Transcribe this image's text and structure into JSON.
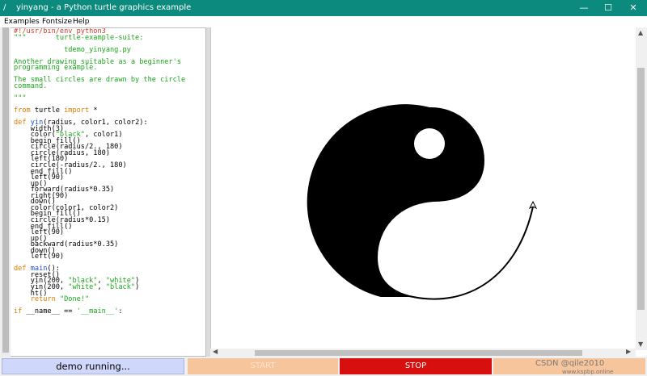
{
  "window": {
    "title": "yinyang - a Python turtle graphics example",
    "controls": {
      "minimize": "—",
      "maximize": "☐",
      "close": "✕"
    }
  },
  "menu": {
    "items": [
      "Examples",
      "Fontsize",
      "Help"
    ]
  },
  "code_lines": [
    [
      {
        "t": "#!/usr/bin/env python3",
        "c": "red"
      }
    ],
    [
      {
        "t": "\"\"\"       turtle-example-suite:",
        "c": "green"
      }
    ],
    [
      {
        "t": "",
        "c": ""
      }
    ],
    [
      {
        "t": "            tdemo_yinyang.py",
        "c": "green"
      }
    ],
    [
      {
        "t": "",
        "c": ""
      }
    ],
    [
      {
        "t": "Another drawing suitable as a beginner's",
        "c": "green"
      }
    ],
    [
      {
        "t": "programming example.",
        "c": "green"
      }
    ],
    [
      {
        "t": "",
        "c": ""
      }
    ],
    [
      {
        "t": "The small circles are drawn by the circle",
        "c": "green"
      }
    ],
    [
      {
        "t": "command.",
        "c": "green"
      }
    ],
    [
      {
        "t": "",
        "c": ""
      }
    ],
    [
      {
        "t": "\"\"\"",
        "c": "green"
      }
    ],
    [
      {
        "t": "",
        "c": ""
      }
    ],
    [
      {
        "t": "from",
        "c": "orange"
      },
      {
        "t": " turtle ",
        "c": ""
      },
      {
        "t": "import",
        "c": "orange"
      },
      {
        "t": " *",
        "c": ""
      }
    ],
    [
      {
        "t": "",
        "c": ""
      }
    ],
    [
      {
        "t": "def",
        "c": "orange"
      },
      {
        "t": " ",
        "c": ""
      },
      {
        "t": "yin",
        "c": "blue"
      },
      {
        "t": "(radius, color1, color2):",
        "c": ""
      }
    ],
    [
      {
        "t": "    width(3)",
        "c": ""
      }
    ],
    [
      {
        "t": "    color(",
        "c": ""
      },
      {
        "t": "\"black\"",
        "c": "green"
      },
      {
        "t": ", color1)",
        "c": ""
      }
    ],
    [
      {
        "t": "    begin_fill()",
        "c": ""
      }
    ],
    [
      {
        "t": "    circle(radius/2., 180)",
        "c": ""
      }
    ],
    [
      {
        "t": "    circle(radius, 180)",
        "c": ""
      }
    ],
    [
      {
        "t": "    left(180)",
        "c": ""
      }
    ],
    [
      {
        "t": "    circle(-radius/2., 180)",
        "c": ""
      }
    ],
    [
      {
        "t": "    end_fill()",
        "c": ""
      }
    ],
    [
      {
        "t": "    left(90)",
        "c": ""
      }
    ],
    [
      {
        "t": "    up()",
        "c": ""
      }
    ],
    [
      {
        "t": "    forward(radius*0.35)",
        "c": ""
      }
    ],
    [
      {
        "t": "    right(90)",
        "c": ""
      }
    ],
    [
      {
        "t": "    down()",
        "c": ""
      }
    ],
    [
      {
        "t": "    color(color1, color2)",
        "c": ""
      }
    ],
    [
      {
        "t": "    begin_fill()",
        "c": ""
      }
    ],
    [
      {
        "t": "    circle(radius*0.15)",
        "c": ""
      }
    ],
    [
      {
        "t": "    end_fill()",
        "c": ""
      }
    ],
    [
      {
        "t": "    left(90)",
        "c": ""
      }
    ],
    [
      {
        "t": "    up()",
        "c": ""
      }
    ],
    [
      {
        "t": "    backward(radius*0.35)",
        "c": ""
      }
    ],
    [
      {
        "t": "    down()",
        "c": ""
      }
    ],
    [
      {
        "t": "    left(90)",
        "c": ""
      }
    ],
    [
      {
        "t": "",
        "c": ""
      }
    ],
    [
      {
        "t": "def",
        "c": "orange"
      },
      {
        "t": " ",
        "c": ""
      },
      {
        "t": "main",
        "c": "blue"
      },
      {
        "t": "():",
        "c": ""
      }
    ],
    [
      {
        "t": "    reset()",
        "c": ""
      }
    ],
    [
      {
        "t": "    yin(200, ",
        "c": ""
      },
      {
        "t": "\"black\"",
        "c": "green"
      },
      {
        "t": ", ",
        "c": ""
      },
      {
        "t": "\"white\"",
        "c": "green"
      },
      {
        "t": ")",
        "c": ""
      }
    ],
    [
      {
        "t": "    yin(200, ",
        "c": ""
      },
      {
        "t": "\"white\"",
        "c": "green"
      },
      {
        "t": ", ",
        "c": ""
      },
      {
        "t": "\"black\"",
        "c": "green"
      },
      {
        "t": ")",
        "c": ""
      }
    ],
    [
      {
        "t": "    ht()",
        "c": ""
      }
    ],
    [
      {
        "t": "    ",
        "c": ""
      },
      {
        "t": "return",
        "c": "orange"
      },
      {
        "t": " ",
        "c": ""
      },
      {
        "t": "\"Done!\"",
        "c": "green"
      }
    ],
    [
      {
        "t": "",
        "c": ""
      }
    ],
    [
      {
        "t": "if",
        "c": "orange"
      },
      {
        "t": " __name__ == ",
        "c": ""
      },
      {
        "t": "'__main__'",
        "c": "green"
      },
      {
        "t": ":",
        "c": ""
      }
    ]
  ],
  "status": {
    "text": "demo running..."
  },
  "buttons": {
    "start": "START",
    "stop": "STOP",
    "clear": ""
  },
  "colors": {
    "titlebar": "#0c8a7e",
    "status_bg": "#cfd8fb",
    "start_bg": "#f6c59c",
    "stop_bg": "#d80f0f"
  },
  "watermark": {
    "line1": "CSDN @qile2010",
    "line2": "www.kspbp.online"
  }
}
